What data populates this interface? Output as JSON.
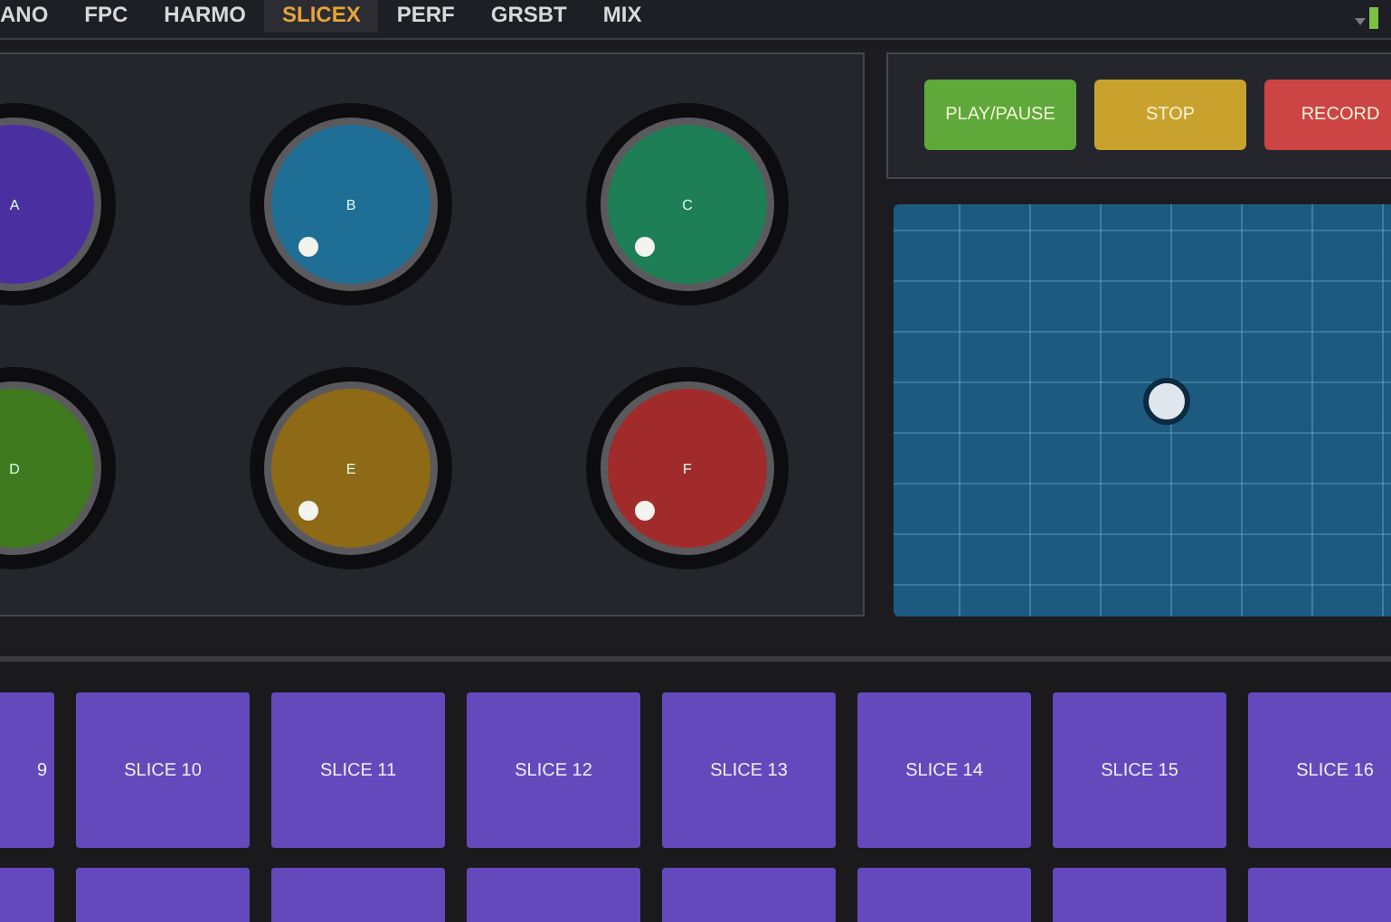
{
  "tabs": [
    {
      "label": "ANO",
      "selected": false
    },
    {
      "label": "FPC",
      "selected": false
    },
    {
      "label": "HARMO",
      "selected": false
    },
    {
      "label": "SLICEX",
      "selected": true
    },
    {
      "label": "PERF",
      "selected": false
    },
    {
      "label": "GRSBT",
      "selected": false
    },
    {
      "label": "MIX",
      "selected": false
    }
  ],
  "knobs": [
    {
      "label": "A",
      "color": "#4a2fa0"
    },
    {
      "label": "B",
      "color": "#1f6e96"
    },
    {
      "label": "C",
      "color": "#1e7e55"
    },
    {
      "label": "D",
      "color": "#3f7a1e"
    },
    {
      "label": "E",
      "color": "#8e6a16"
    },
    {
      "label": "F",
      "color": "#a12a2a"
    }
  ],
  "transport": [
    {
      "label": "PLAY/PAUSE",
      "color": "#5fa83a"
    },
    {
      "label": "STOP",
      "color": "#c9a22e"
    },
    {
      "label": "RECORD",
      "color": "#cc4444"
    }
  ],
  "slices": [
    {
      "label": "9"
    },
    {
      "label": "SLICE 10"
    },
    {
      "label": "SLICE 11"
    },
    {
      "label": "SLICE 12"
    },
    {
      "label": "SLICE 13"
    },
    {
      "label": "SLICE 14"
    },
    {
      "label": "SLICE 15"
    },
    {
      "label": "SLICE 16"
    }
  ]
}
